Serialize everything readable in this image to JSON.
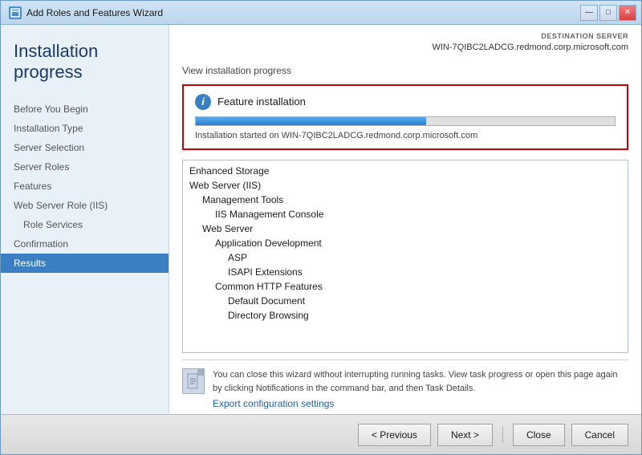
{
  "window": {
    "title": "Add Roles and Features Wizard",
    "icon": "wizard-icon"
  },
  "title_controls": {
    "minimize": "—",
    "maximize": "□",
    "close": "✕"
  },
  "dest_server": {
    "label": "DESTINATION SERVER",
    "name": "WIN-7QIBC2LADCG.redmond.corp.microsoft.com"
  },
  "page": {
    "title": "Installation progress"
  },
  "nav": {
    "items": [
      {
        "id": "before-you-begin",
        "label": "Before You Begin",
        "sub": false,
        "active": false
      },
      {
        "id": "installation-type",
        "label": "Installation Type",
        "sub": false,
        "active": false
      },
      {
        "id": "server-selection",
        "label": "Server Selection",
        "sub": false,
        "active": false
      },
      {
        "id": "server-roles",
        "label": "Server Roles",
        "sub": false,
        "active": false
      },
      {
        "id": "features",
        "label": "Features",
        "sub": false,
        "active": false
      },
      {
        "id": "web-server-role",
        "label": "Web Server Role (IIS)",
        "sub": false,
        "active": false
      },
      {
        "id": "role-services",
        "label": "Role Services",
        "sub": true,
        "active": false
      },
      {
        "id": "confirmation",
        "label": "Confirmation",
        "sub": false,
        "active": false
      },
      {
        "id": "results",
        "label": "Results",
        "sub": false,
        "active": true
      }
    ]
  },
  "main": {
    "section_title": "View installation progress",
    "feature_box": {
      "icon": "i",
      "title": "Feature installation",
      "progress_percent": 55,
      "progress_text": "Installation started on WIN-7QIBC2LADCG.redmond.corp.microsoft.com"
    },
    "features_list": [
      {
        "label": "Enhanced Storage",
        "indent": 0
      },
      {
        "label": "Web Server (IIS)",
        "indent": 0
      },
      {
        "label": "Management Tools",
        "indent": 1
      },
      {
        "label": "IIS Management Console",
        "indent": 2
      },
      {
        "label": "Web Server",
        "indent": 1
      },
      {
        "label": "Application Development",
        "indent": 2
      },
      {
        "label": "ASP",
        "indent": 3
      },
      {
        "label": "ISAPI Extensions",
        "indent": 3
      },
      {
        "label": "Common HTTP Features",
        "indent": 2
      },
      {
        "label": "Default Document",
        "indent": 3
      },
      {
        "label": "Directory Browsing",
        "indent": 3
      }
    ],
    "info_text": "You can close this wizard without interrupting running tasks. View task progress or open this page again by clicking Notifications in the command bar, and then Task Details.",
    "export_link": "Export configuration settings"
  },
  "buttons": {
    "previous": "< Previous",
    "next": "Next >",
    "close": "Close",
    "cancel": "Cancel"
  }
}
